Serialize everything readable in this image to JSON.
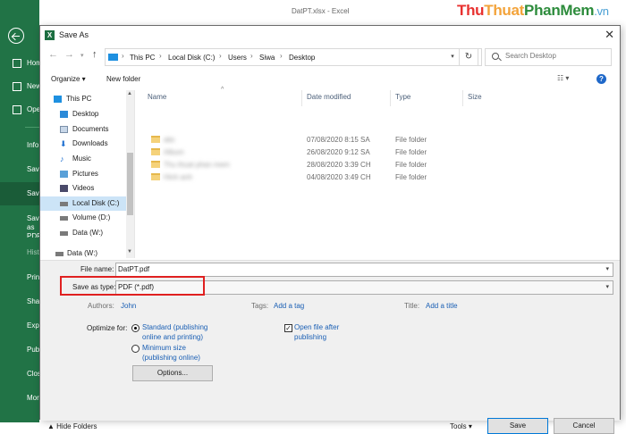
{
  "excel": {
    "title": "DatPT.xlsx - Excel",
    "brand": {
      "p1": "Thu",
      "p2": "Thuat",
      "p3": "PhanMem",
      "p4": ".vn"
    },
    "backstage_items": [
      {
        "label": "Home"
      },
      {
        "label": "New"
      },
      {
        "label": "Open"
      },
      {
        "label": "Info"
      },
      {
        "label": "Save"
      },
      {
        "label": "Save As"
      },
      {
        "label": "Save as PDF"
      },
      {
        "label": "History"
      },
      {
        "label": "Print"
      },
      {
        "label": "Share"
      },
      {
        "label": "Export"
      },
      {
        "label": "Publish"
      },
      {
        "label": "Close"
      },
      {
        "label": "More"
      }
    ]
  },
  "dialog": {
    "title": "Save As",
    "breadcrumb": [
      "This PC",
      "Local Disk (C:)",
      "Users",
      "Siwa",
      "Desktop"
    ],
    "search_placeholder": "Search Desktop",
    "toolbar": {
      "organize": "Organize ▾",
      "new_folder": "New folder"
    },
    "tree": [
      {
        "label": "This PC",
        "icon": "computer-icon"
      },
      {
        "label": "Desktop",
        "icon": "desktop-icon"
      },
      {
        "label": "Documents",
        "icon": "documents-icon"
      },
      {
        "label": "Downloads",
        "icon": "downloads-icon"
      },
      {
        "label": "Music",
        "icon": "music-icon"
      },
      {
        "label": "Pictures",
        "icon": "pictures-icon"
      },
      {
        "label": "Videos",
        "icon": "videos-icon"
      },
      {
        "label": "Local Disk (C:)",
        "icon": "drive-icon"
      },
      {
        "label": "Volume (D:)",
        "icon": "drive-icon"
      },
      {
        "label": "Data (W:)",
        "icon": "drive-icon"
      },
      {
        "label": "Data (W:)",
        "icon": "drive-icon"
      }
    ],
    "columns": {
      "name": "Name",
      "date": "Date modified",
      "type": "Type",
      "size": "Size"
    },
    "files": [
      {
        "name": "abc",
        "date": "07/08/2020 8:15 SA",
        "type": "File folder"
      },
      {
        "name": "Album",
        "date": "26/08/2020 9:12 SA",
        "type": "File folder"
      },
      {
        "name": "Thu thuat phan mem",
        "date": "28/08/2020 3:39 CH",
        "type": "File folder"
      },
      {
        "name": "Hinh anh",
        "date": "04/08/2020 3:49 CH",
        "type": "File folder"
      }
    ],
    "file_name_label": "File name:",
    "file_name_value": "DatPT.pdf",
    "save_type_label": "Save as type:",
    "save_type_value": "PDF (*.pdf)",
    "authors_label": "Authors:",
    "authors_value": "John",
    "tags_label": "Tags:",
    "tags_value": "Add a tag",
    "title_label": "Title:",
    "title_value": "Add a title",
    "optimize_label": "Optimize for:",
    "optimize_standard": "Standard (publishing online and printing)",
    "optimize_minimum": "Minimum size (publishing online)",
    "open_after_label": "Open file after publishing",
    "options_button": "Options...",
    "hide_folders": "Hide Folders",
    "tools": "Tools",
    "save_button": "Save",
    "cancel_button": "Cancel"
  },
  "colors": {
    "excel_green": "#217346",
    "highlight": "#e02020",
    "link": "#1a5fb4"
  }
}
